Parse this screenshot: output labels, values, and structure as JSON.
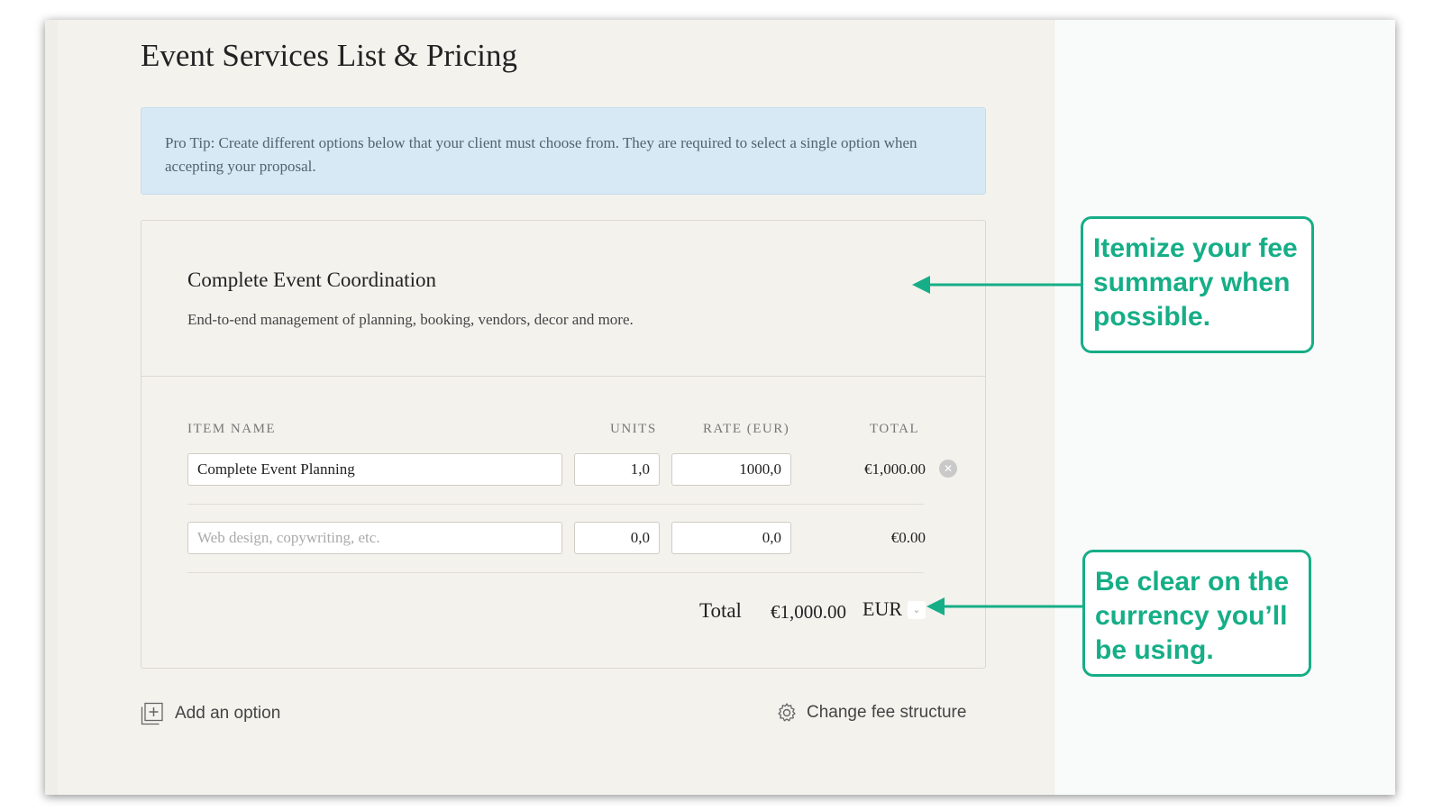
{
  "page": {
    "title": "Event Services List & Pricing",
    "pro_tip": "Pro Tip:  Create different options below that your client must choose from. They are required to select a single option when accepting your proposal."
  },
  "option": {
    "title": "Complete Event Coordination",
    "description": "End-to-end management of planning, booking, vendors, decor and more.",
    "columns": {
      "item_name": "ITEM NAME",
      "units": "UNITS",
      "rate": "RATE (EUR)",
      "total": "TOTAL"
    },
    "items": [
      {
        "name": "Complete Event Planning",
        "units": "1,0",
        "rate": "1000,0",
        "total": "€1,000.00",
        "removable": true
      },
      {
        "name": "",
        "name_placeholder": "Web design, copywriting, etc.",
        "units": "0,0",
        "rate": "0,0",
        "total": "€0.00"
      }
    ],
    "total_label": "Total",
    "total_value": "€1,000.00",
    "currency": "EUR"
  },
  "footer": {
    "add_option": "Add an option",
    "change_fee": "Change fee structure"
  },
  "callouts": [
    {
      "text": "Itemize your fee summary when possible."
    },
    {
      "text": "Be clear on the currency you’ll be using."
    }
  ],
  "colors": {
    "accent": "#16ae87",
    "tip_bg": "#d6e9f5",
    "panel_bg": "#f4f2ed"
  },
  "icons": [
    "add-square-icon",
    "gear-icon",
    "remove-circle-icon",
    "chevron-down-icon",
    "arrow-left-icon"
  ]
}
